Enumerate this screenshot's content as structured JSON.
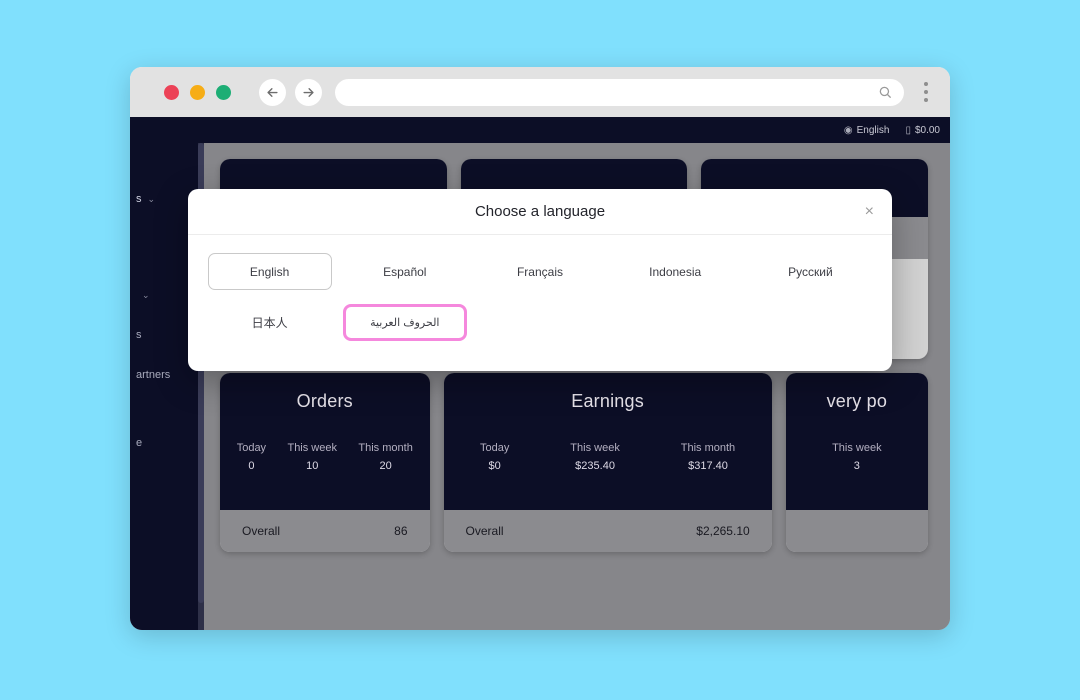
{
  "browser": {
    "url_value": "",
    "url_placeholder": "",
    "back_label": "Back",
    "forward_label": "Forward",
    "menu_label": "More options"
  },
  "app_header": {
    "language_label": "English",
    "balance_label": "$0.00"
  },
  "sidebar": {
    "items": [
      {
        "label": "s",
        "chevron": "⌄"
      },
      {
        "label": "",
        "chevron": "⌄"
      },
      {
        "label": "s",
        "chevron": ""
      },
      {
        "label": "artners",
        "chevron": ""
      },
      {
        "label": "e",
        "chevron": ""
      }
    ]
  },
  "modal": {
    "title": "Choose a language",
    "close_label": "×",
    "languages": [
      {
        "label": "English",
        "state": "selected"
      },
      {
        "label": "Español",
        "state": "normal"
      },
      {
        "label": "Français",
        "state": "normal"
      },
      {
        "label": "Indonesia",
        "state": "normal"
      },
      {
        "label": "Русский",
        "state": "normal"
      },
      {
        "label": "日本人",
        "state": "normal"
      },
      {
        "label": "الحروف العربية",
        "state": "highlighted"
      }
    ]
  },
  "cards": {
    "hidden_row": [
      {
        "title": "",
        "metrics": [],
        "footer_label": "",
        "footer_value": ""
      },
      {
        "title": "",
        "metrics": [],
        "footer_label": "",
        "footer_value": ""
      },
      {
        "title": "",
        "metrics": [],
        "footer_label": "",
        "footer_value": ""
      }
    ],
    "orders": {
      "title": "Orders",
      "metrics": [
        {
          "label": "Today",
          "value": "0"
        },
        {
          "label": "This week",
          "value": "10"
        },
        {
          "label": "This month",
          "value": "20"
        }
      ],
      "footer_label": "Overall",
      "footer_value": "86"
    },
    "earnings": {
      "title": "Earnings",
      "metrics": [
        {
          "label": "Today",
          "value": "$0"
        },
        {
          "label": "This week",
          "value": "$235.40"
        },
        {
          "label": "This month",
          "value": "$317.40"
        }
      ],
      "footer_label": "Overall",
      "footer_value": "$2,265.10"
    },
    "delivery": {
      "title": "very po",
      "metrics": [
        {
          "label": "This week",
          "value": "3"
        }
      ],
      "footer_label": "",
      "footer_value": ""
    }
  },
  "colors": {
    "page_background": "#80e0fd",
    "app_dark": "#0c0e26",
    "overlay_gray": "#86868a",
    "highlight_pink": "#f588dd",
    "card_footer": "#8b8b8f"
  }
}
